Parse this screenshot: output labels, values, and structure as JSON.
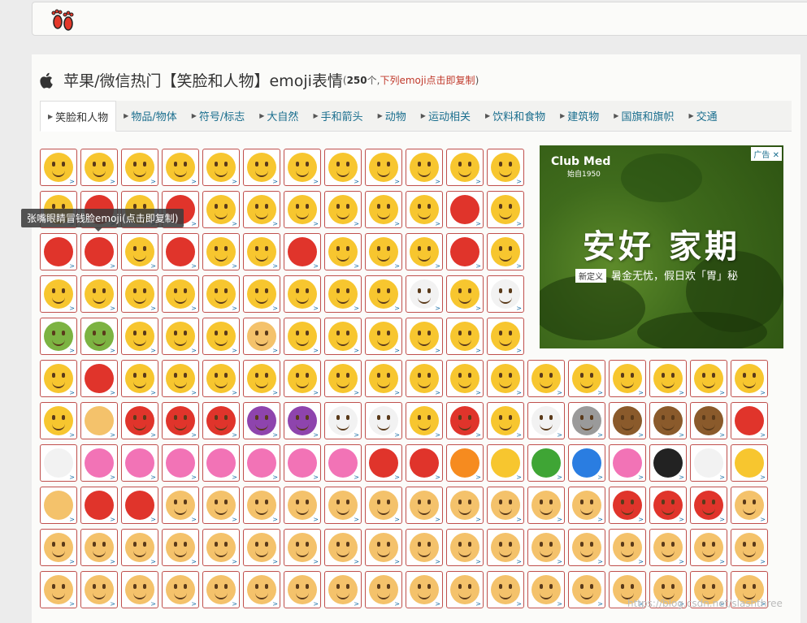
{
  "header": {
    "logo_icon": "footprints-icon"
  },
  "title": {
    "icon": "apple-icon",
    "text": "苹果/微信热门【笑脸和人物】emoji表情",
    "count_open": "(",
    "count": "250",
    "count_unit": "个,",
    "hint": "下列emoji点击即复制",
    "count_close": ")"
  },
  "tabs": [
    {
      "label": "笑脸和人物",
      "active": true
    },
    {
      "label": "物品/物体"
    },
    {
      "label": "符号/标志"
    },
    {
      "label": "大自然"
    },
    {
      "label": "手和箭头"
    },
    {
      "label": "动物"
    },
    {
      "label": "运动相关"
    },
    {
      "label": "饮料和食物"
    },
    {
      "label": "建筑物"
    },
    {
      "label": "国旗和旗帜"
    },
    {
      "label": "交通"
    }
  ],
  "tooltip": "张嘴眼睛冒钱脸emoji(点击即复制)",
  "cell_arrow": ">",
  "ad": {
    "brand": "Club Med",
    "since": "始自1950",
    "badge": "广告",
    "close_icon": "close-icon",
    "headline": "安好 家期",
    "tag": "新定义",
    "subline": "暑金无忧，假日欢「胃」秘"
  },
  "watermark": "https://blog.csdn.net/slashthree",
  "colors": {
    "accent_border": "#c0504d",
    "tab_link": "#1a6e8e",
    "hint_red": "#c0392b",
    "emoji_yellow": "#f7c62f",
    "emoji_red": "#e0342b",
    "emoji_pink": "#f273b6",
    "emoji_green": "#3fa535",
    "emoji_blue": "#2a7de1",
    "emoji_black": "#222222",
    "emoji_white": "#f2f2f2",
    "emoji_orange": "#f68b1f",
    "emoji_skin": "#f4c26b",
    "emoji_brown": "#8a5a2b",
    "emoji_gray": "#9a9a9a"
  },
  "rows": [
    {
      "emojis": [
        "grinning-face",
        "grinning-face-big-eyes",
        "grinning-smiling-eyes",
        "beaming-face",
        "grinning-squinting-face",
        "grinning-sweat",
        "rolling-laughing",
        "tears-of-joy",
        "slightly-smiling",
        "upside-down",
        "winking",
        "smiling-eyes"
      ]
    },
    {
      "emojis": [
        "halo-face",
        "heart-eyes",
        "star-struck",
        "kissing-heart",
        "kissing-face",
        "smiling-relaxed",
        "kissing-closed-eyes",
        "kissing-smiling-eyes",
        "yum-face",
        "tongue-out",
        "winking-tongue",
        "zany-face"
      ]
    },
    {
      "emojis": [
        "squinting-tongue",
        "money-mouth",
        "hugging-face",
        "hand-over-mouth",
        "shushing-face",
        "thinking-face",
        "zipper-mouth",
        "raised-eyebrow",
        "neutral-face",
        "expressionless",
        "no-mouth",
        "smirking-face"
      ]
    },
    {
      "emojis": [
        "unamused",
        "rolling-eyes",
        "grimacing",
        "lying-face",
        "relieved",
        "pensive",
        "sleepy",
        "drooling",
        "sleeping",
        "medical-mask",
        "thermometer-face",
        "head-bandage"
      ]
    },
    {
      "emojis": [
        "nauseated",
        "vomiting",
        "sneezing",
        "dizzy-face",
        "exploding-head",
        "cowboy",
        "sunglasses",
        "nerd-face",
        "monocle",
        "confused",
        "worried",
        "slightly-frowning"
      ]
    },
    {
      "emojis": [
        "frowning",
        "open-mouth",
        "hushed",
        "astonished",
        "flushed",
        "frowning-open",
        "anguished",
        "fearful",
        "anxious-sweat",
        "sad-relieved",
        "crying",
        "loudly-crying",
        "screaming",
        "confounded",
        "persevering",
        "disappointed",
        "downcast-sweat",
        "weary"
      ]
    },
    {
      "emojis": [
        "tired",
        "steam-nose",
        "pouting",
        "angry",
        "cursing",
        "smiling-horns",
        "angry-horns",
        "skull",
        "crossbones",
        "clown",
        "ogre",
        "goblin",
        "ghost",
        "alien",
        "see-no-evil",
        "hear-no-evil",
        "speak-no-evil",
        "kiss-mark"
      ]
    },
    {
      "emojis": [
        "love-letter",
        "heart-arrow",
        "heart-ribbon",
        "sparkling-heart",
        "growing-heart",
        "beating-heart",
        "revolving-hearts",
        "two-hearts",
        "broken-heart",
        "red-heart",
        "orange-heart",
        "yellow-heart",
        "green-heart",
        "blue-heart",
        "purple-heart",
        "black-heart",
        "speech-balloon",
        "selfie"
      ]
    },
    {
      "emojis": [
        "nose",
        "tongue",
        "mouth",
        "baby",
        "child",
        "boy",
        "girl",
        "man",
        "woman",
        "older-man",
        "older-woman",
        "person-frowning",
        "man-frowning",
        "woman-frowning",
        "person-pouting",
        "man-pouting",
        "woman-pouting",
        "person-no-gesture"
      ]
    },
    {
      "emojis": [
        "man-no-gesture",
        "woman-no-gesture",
        "person-ok-gesture",
        "man-ok-gesture",
        "woman-ok-gesture",
        "person-tipping",
        "man-tipping",
        "woman-tipping",
        "person-raising-hand",
        "man-raising-hand",
        "woman-raising-hand",
        "person-bowing",
        "man-bowing",
        "woman-bowing",
        "person-facepalm",
        "man-facepalm",
        "woman-facepalm",
        "person-shrugging"
      ]
    },
    {
      "emojis": [
        "man-shrugging",
        "woman-shrugging",
        "man-health",
        "woman-health",
        "man-student",
        "woman-student",
        "man-teacher",
        "woman-teacher",
        "man-judge",
        "woman-judge",
        "man-farmer",
        "woman-farmer",
        "man-cook",
        "woman-cook",
        "man-mechanic",
        "woman-mechanic",
        "man-factory",
        "woman-factory"
      ]
    }
  ]
}
